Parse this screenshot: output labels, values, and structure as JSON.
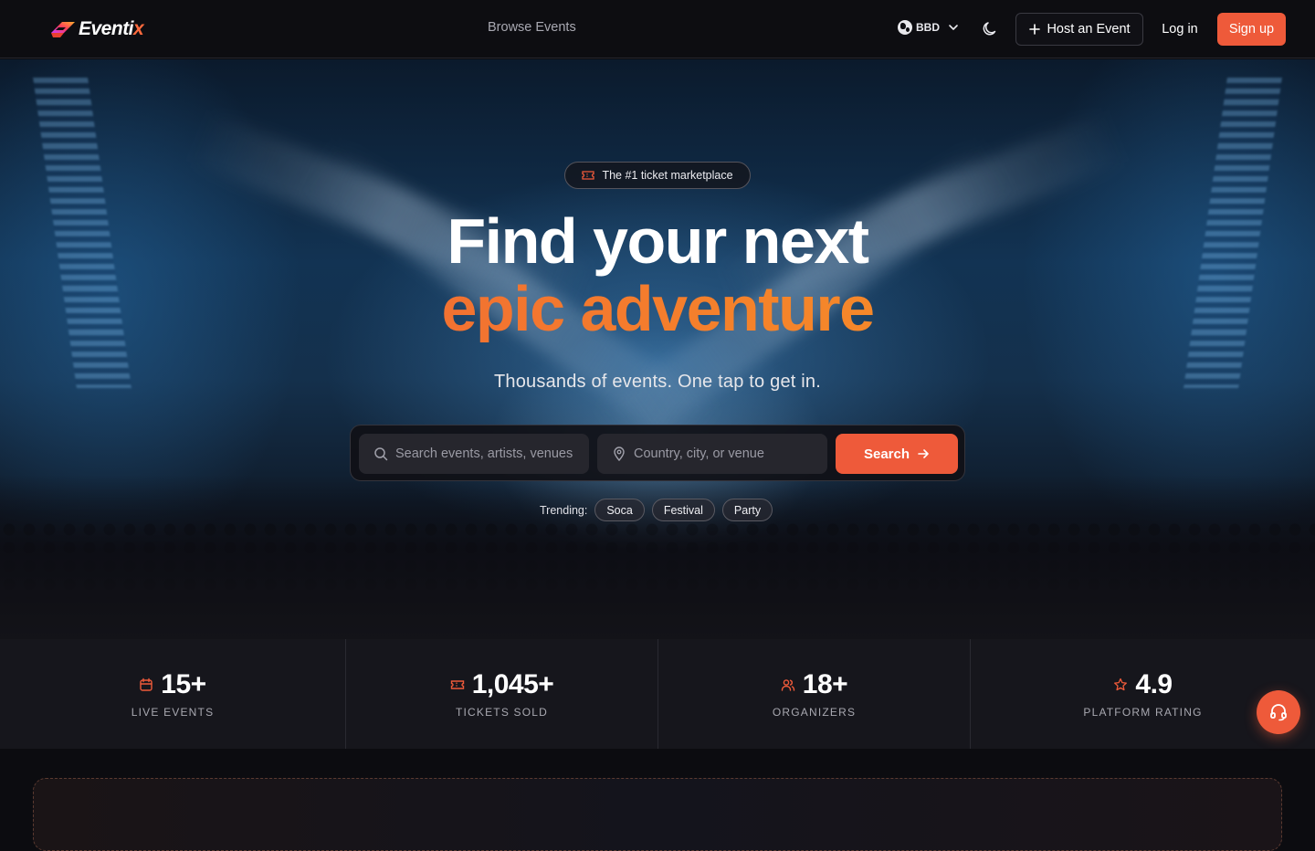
{
  "brand": {
    "name_main": "Eventi",
    "name_accent": "x",
    "accent_color": "#ee5a3a"
  },
  "nav": {
    "browse_label": "Browse Events",
    "currency": "BBD",
    "host_label": "Host an Event",
    "login_label": "Log in",
    "signup_label": "Sign up"
  },
  "hero": {
    "badge": "The #1 ticket marketplace",
    "title_line1": "Find your next",
    "title_line2": "epic adventure",
    "subtitle": "Thousands of events. One tap to get in.",
    "search_placeholder": "Search events, artists, venues",
    "location_placeholder": "Country, city, or venue",
    "search_button": "Search",
    "trending_label": "Trending:",
    "trending": [
      "Soca",
      "Festival",
      "Party"
    ]
  },
  "stats": [
    {
      "icon": "calendar-icon",
      "value": "15+",
      "label": "LIVE EVENTS"
    },
    {
      "icon": "ticket-icon",
      "value": "1,045+",
      "label": "TICKETS SOLD"
    },
    {
      "icon": "users-icon",
      "value": "18+",
      "label": "ORGANIZERS"
    },
    {
      "icon": "star-icon",
      "value": "4.9",
      "label": "PLATFORM RATING"
    }
  ],
  "icons": {
    "support": "headset-icon",
    "theme": "moon-icon",
    "currency": "globe-icon"
  }
}
